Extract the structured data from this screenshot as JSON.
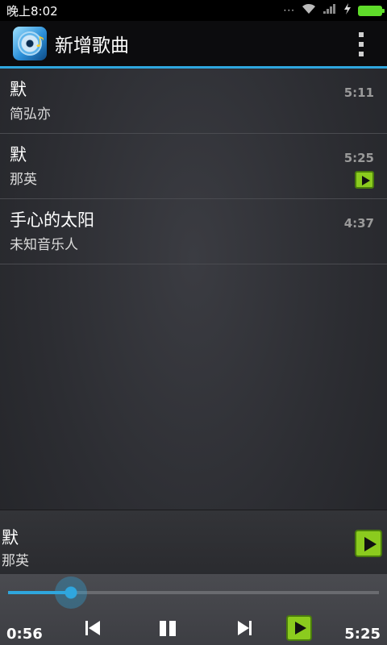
{
  "status_bar": {
    "time": "晚上8:02",
    "indicators": "···"
  },
  "app_bar": {
    "title": "新增歌曲"
  },
  "songs": [
    {
      "title": "默",
      "artist": "简弘亦",
      "duration": "5:11",
      "playing": false
    },
    {
      "title": "默",
      "artist": "那英",
      "duration": "5:25",
      "playing": true
    },
    {
      "title": "手心的太阳",
      "artist": "未知音乐人",
      "duration": "4:37",
      "playing": false
    }
  ],
  "now_playing": {
    "title": "默",
    "artist": "那英"
  },
  "player": {
    "current_time": "0:56",
    "total_time": "5:25",
    "progress": 0.17
  },
  "colors": {
    "accent": "#2fa6de",
    "play_green": "#8bcb1e"
  }
}
